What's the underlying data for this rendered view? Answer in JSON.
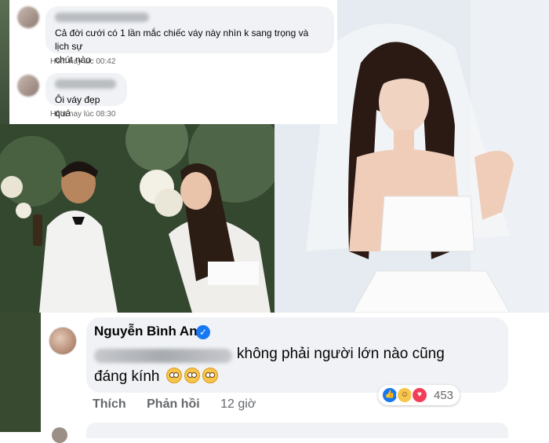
{
  "top_comments": [
    {
      "text_line1": "Cả đời cưới có 1 lần mắc chiếc váy này nhìn k sang trọng và lịch sự",
      "text_line2": "chút nào",
      "time": "Hôm nay lúc 00:42"
    },
    {
      "text_line1": "Ôi váy đẹp quá",
      "time": "Hôm nay lúc 08:30"
    }
  ],
  "main_comment": {
    "author": "Nguyễn Bình An",
    "verified": true,
    "text_line1": "không phải người lớn nào cũng",
    "text_line2": "đáng kính",
    "emoji_count": 3,
    "like_label": "Thích",
    "reply_label": "Phản hồi",
    "time": "12 giờ",
    "reaction_count": "453",
    "reaction_icons": [
      "like-icon",
      "haha-icon",
      "love-icon"
    ]
  },
  "colors": {
    "facebook_blue": "#1877f2",
    "bubble_gray": "#f0f2f5",
    "meta_gray": "#65676b"
  }
}
